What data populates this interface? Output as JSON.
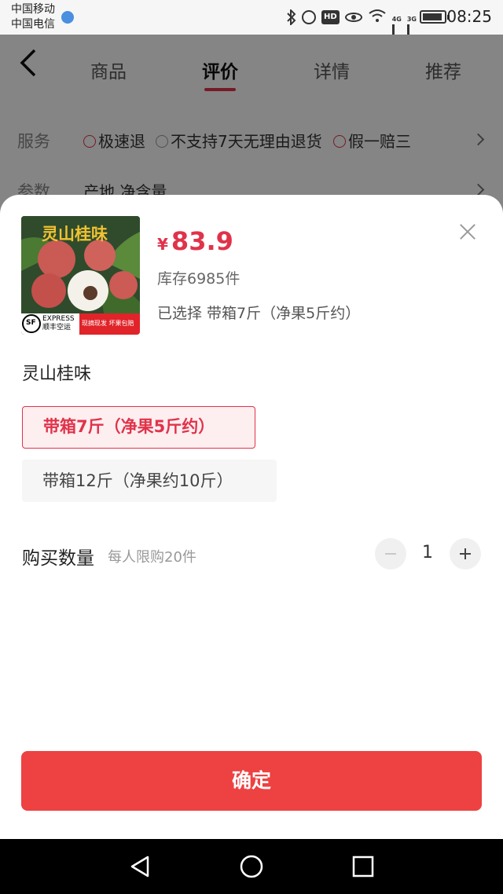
{
  "status_bar": {
    "carrier_1": "中国移动",
    "carrier_2": "中国电信",
    "net_4g": "4G",
    "net_3g": "3G",
    "hd": "HD",
    "time": "08:25"
  },
  "top_nav": {
    "tabs": [
      {
        "label": "商品"
      },
      {
        "label": "评价"
      },
      {
        "label": "详情"
      },
      {
        "label": "推荐"
      }
    ],
    "active_tab": "评价"
  },
  "services": {
    "label": "服务",
    "items": [
      "极速退",
      "不支持7天无理由退货",
      "假一赔三"
    ]
  },
  "params": {
    "label": "参数",
    "value": "产地 净含量"
  },
  "sheet": {
    "image": {
      "title": "灵山桂味",
      "express": "EXPRESS",
      "express_cn": "顺丰空运",
      "tag": "现摘现发 坏果包赔"
    },
    "price_currency": "¥",
    "price": "83.9",
    "stock": "库存6985件",
    "selected_label": "已选择",
    "selected_value": "带箱7斤（净果5斤约）",
    "option_group_title": "灵山桂味",
    "options": [
      {
        "label": "带箱7斤（净果5斤约）",
        "selected": true
      },
      {
        "label": "带箱12斤（净果约10斤）",
        "selected": false
      }
    ],
    "quantity": {
      "label": "购买数量",
      "limit": "每人限购20件",
      "value": "1"
    },
    "confirm_label": "确定"
  },
  "colors": {
    "accent": "#e0334a",
    "confirm_bg": "#ee4142"
  }
}
